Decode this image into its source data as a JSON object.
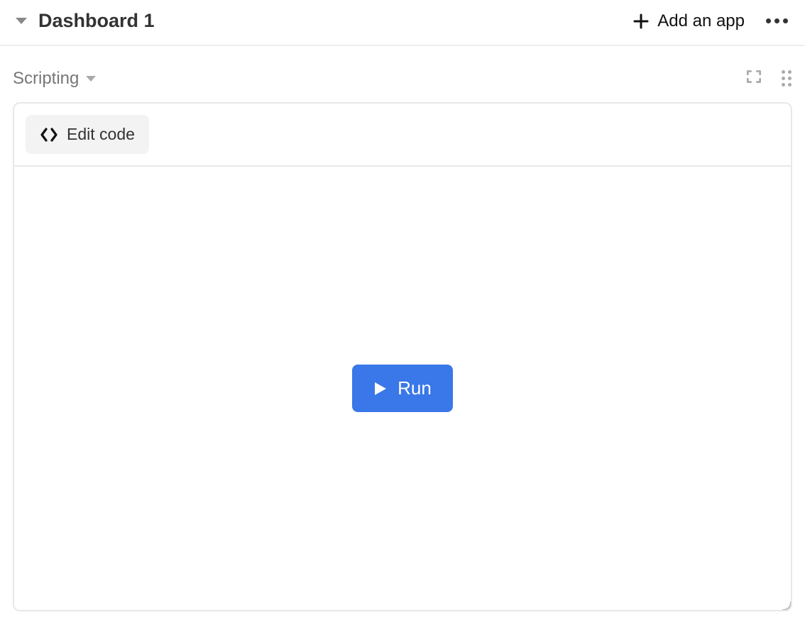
{
  "header": {
    "title": "Dashboard 1",
    "add_app_label": "Add an app"
  },
  "subheader": {
    "scripting_label": "Scripting"
  },
  "panel": {
    "edit_code_label": "Edit code",
    "run_label": "Run"
  }
}
